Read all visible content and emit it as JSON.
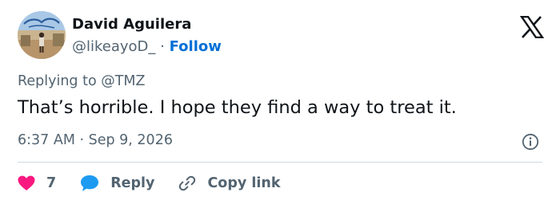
{
  "author": {
    "name": "David Aguilera",
    "handle": "@likeayoD_",
    "separator": "·",
    "follow_label": "Follow"
  },
  "reply_context": {
    "prefix": "Replying to ",
    "mention": "@TMZ"
  },
  "tweet": {
    "text": "That’s horrible. I hope they find a way to treat it.",
    "timestamp": "6:37 AM · Sep 9, 2026"
  },
  "actions": {
    "like_count": "7",
    "reply_label": "Reply",
    "copy_link_label": "Copy link"
  },
  "icons": {
    "brand": "x-logo-icon",
    "info": "info-icon",
    "like": "heart-icon",
    "reply": "speech-bubble-icon",
    "copy": "link-icon"
  },
  "colors": {
    "text_primary": "#0f1419",
    "text_secondary": "#536471",
    "link_blue": "#006fd6",
    "heart": "#f91880",
    "reply_bubble": "#1d9bf0",
    "divider": "#cfd9de"
  }
}
